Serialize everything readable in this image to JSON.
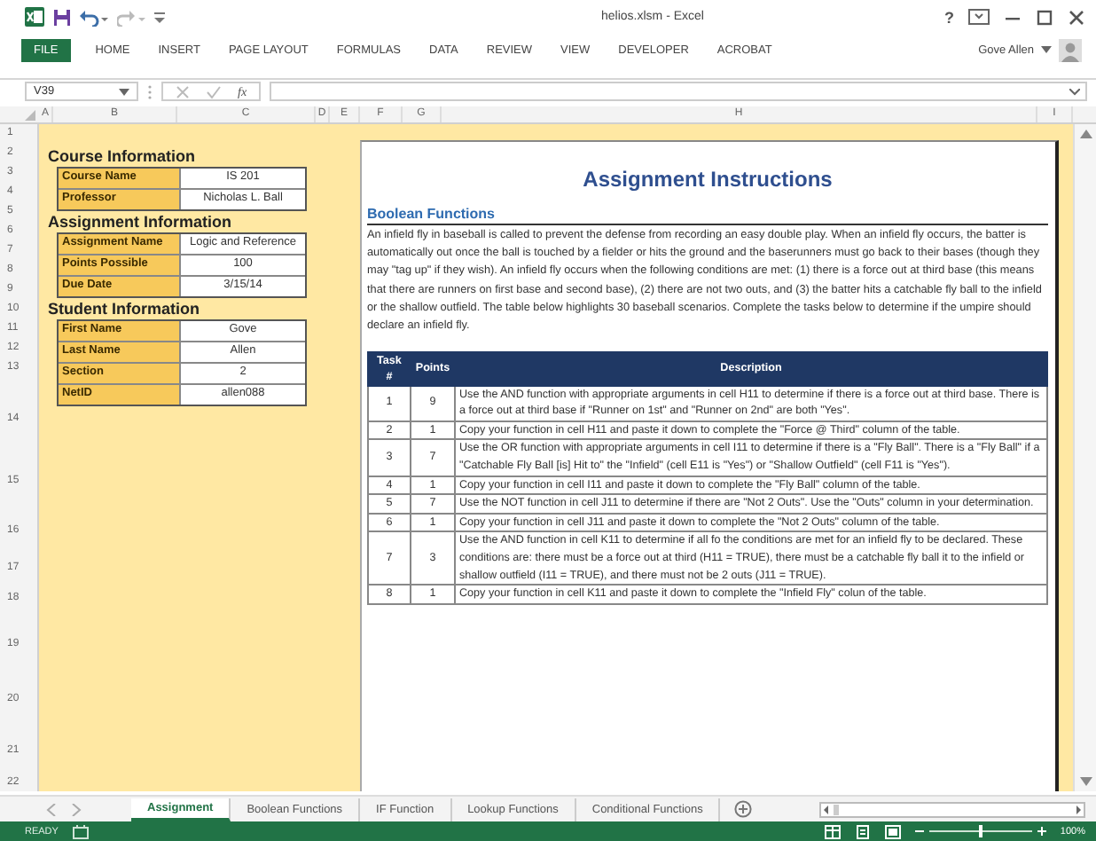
{
  "window": {
    "title": "helios.xlsm - Excel",
    "help": "?",
    "user": "Gove Allen"
  },
  "file_tab": "FILE",
  "ribbon_tabs": [
    "HOME",
    "INSERT",
    "PAGE LAYOUT",
    "FORMULAS",
    "DATA",
    "REVIEW",
    "VIEW",
    "DEVELOPER",
    "ACROBAT"
  ],
  "formula_bar": {
    "name_box": "V39",
    "function_label": "fx"
  },
  "column_headers": [
    "A",
    "B",
    "C",
    "D",
    "E",
    "F",
    "G",
    "H",
    "I"
  ],
  "row_numbers": [
    "1",
    "2",
    "3",
    "4",
    "5",
    "6",
    "7",
    "8",
    "9",
    "10",
    "11",
    "12",
    "13",
    "14",
    "15",
    "16",
    "17",
    "18",
    "19",
    "20",
    "21",
    "22"
  ],
  "info_sections": [
    {
      "title": "Course Information",
      "fields": [
        {
          "label": "Course Name",
          "value": "IS 201"
        },
        {
          "label": "Professor",
          "value": "Nicholas L. Ball"
        }
      ]
    },
    {
      "title": "Assignment Information",
      "fields": [
        {
          "label": "Assignment Name",
          "value": "Logic and Reference"
        },
        {
          "label": "Points Possible",
          "value": "100"
        },
        {
          "label": "Due Date",
          "value": "3/15/14"
        }
      ]
    },
    {
      "title": "Student Information",
      "fields": [
        {
          "label": "First Name",
          "value": "Gove"
        },
        {
          "label": "Last Name",
          "value": "Allen"
        },
        {
          "label": "Section",
          "value": "2"
        },
        {
          "label": "NetID",
          "value": "allen088"
        }
      ]
    }
  ],
  "instructions": {
    "title": "Assignment Instructions",
    "section": "Boolean Functions",
    "paragraph": "An infield fly in baseball is called to prevent the defense from recording an easy double play. When an infield fly occurs, the batter is automatically out once the ball is touched by a fielder or hits the ground and the baserunners must go back to their bases (though they may \"tag up\" if they wish). An infield fly occurs when the following conditions are met: (1) there is a force out at third base (this means that there are runners on first base and second base), (2) there are not two outs, and (3) the batter hits a catchable fly ball to the infield or the shallow outfield. The table below highlights 30 baseball scenarios. Complete the tasks below to determine if the umpire should declare an infield fly.",
    "table": {
      "columns": [
        "Task #",
        "Points",
        "Description"
      ],
      "rows": [
        {
          "task": "1",
          "points": "9",
          "description": "Use the AND function with appropriate arguments in cell H11 to determine if there is a force out at third base. There is a force out at third base if \"Runner on 1st\" and \"Runner on 2nd\" are both \"Yes\"."
        },
        {
          "task": "2",
          "points": "1",
          "description": "Copy your function in cell H11 and paste it down to complete the \"Force @ Third\" column of the table."
        },
        {
          "task": "3",
          "points": "7",
          "description": "Use the OR function with appropriate arguments in cell I11 to determine if there is a \"Fly Ball\". There is a \"Fly Ball\" if a \"Catchable Fly Ball [is] Hit to\" the \"Infield\" (cell E11 is \"Yes\") or \"Shallow Outfield\" (cell F11 is \"Yes\")."
        },
        {
          "task": "4",
          "points": "1",
          "description": "Copy your function in cell I11 and paste it down to complete the \"Fly Ball\" column of the table."
        },
        {
          "task": "5",
          "points": "7",
          "description": "Use the NOT function in cell J11 to determine if there are \"Not 2 Outs\". Use the \"Outs\" column in your determination."
        },
        {
          "task": "6",
          "points": "1",
          "description": "Copy your function in cell J11 and paste it down to complete the \"Not 2 Outs\" column of the table."
        },
        {
          "task": "7",
          "points": "3",
          "description": "Use the AND function in cell K11 to determine if all fo the conditions are met for an infield fly to be declared. These conditions are: there must be a force out at third (H11 = TRUE), there must be a catchable fly ball it to the infield or shallow outfield (I11 = TRUE), and there must not be 2 outs (J11 = TRUE)."
        },
        {
          "task": "8",
          "points": "1",
          "description": "Copy your function in cell K11 and paste it down to complete the \"Infield Fly\" colun of the table."
        }
      ]
    }
  },
  "sheet_tabs": [
    {
      "label": "Assignment",
      "selected": true
    },
    {
      "label": "Boolean Functions",
      "selected": false
    },
    {
      "label": "IF Function",
      "selected": false
    },
    {
      "label": "Lookup Functions",
      "selected": false
    },
    {
      "label": "Conditional Functions",
      "selected": false
    }
  ],
  "status_bar": {
    "mode": "READY",
    "zoom_slider": {
      "level": 0.5
    },
    "zoom": "100%"
  }
}
